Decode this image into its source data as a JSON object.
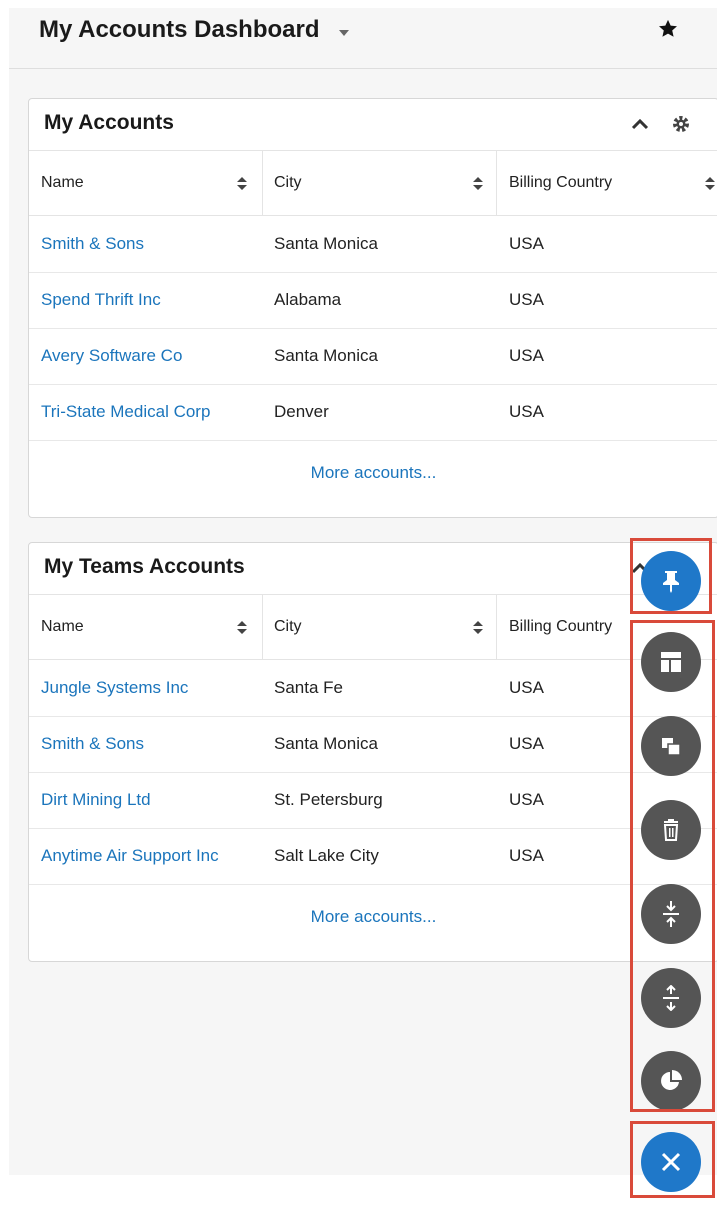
{
  "header": {
    "title": "My Accounts Dashboard"
  },
  "dashlet1": {
    "title": "My Accounts",
    "columns": [
      "Name",
      "City",
      "Billing Country"
    ],
    "rows": [
      {
        "name": "Smith & Sons",
        "city": "Santa Monica",
        "country": "USA"
      },
      {
        "name": "Spend Thrift Inc",
        "city": "Alabama",
        "country": "USA"
      },
      {
        "name": "Avery Software Co",
        "city": "Santa Monica",
        "country": "USA"
      },
      {
        "name": "Tri-State Medical Corp",
        "city": "Denver",
        "country": "USA"
      }
    ],
    "more_label": "More accounts..."
  },
  "dashlet2": {
    "title": "My Teams Accounts",
    "columns": [
      "Name",
      "City",
      "Billing Country"
    ],
    "rows": [
      {
        "name": "Jungle Systems Inc",
        "city": "Santa Fe",
        "country": "USA"
      },
      {
        "name": "Smith & Sons",
        "city": "Santa Monica",
        "country": "USA"
      },
      {
        "name": "Dirt Mining Ltd",
        "city": "St. Petersburg",
        "country": "USA"
      },
      {
        "name": "Anytime Air Support Inc",
        "city": "Salt Lake City",
        "country": "USA"
      }
    ],
    "more_label": "More accounts..."
  },
  "fab_menu": {
    "icons": [
      "pin-icon",
      "layout-icon",
      "duplicate-icon",
      "trash-icon",
      "collapse-all-icon",
      "expand-all-icon",
      "pie-chart-icon",
      "close-icon"
    ]
  },
  "colors": {
    "link": "#1b75bc",
    "fab_blue": "#1f78c9",
    "fab_gray": "#555555",
    "highlight": "#d94a3a"
  }
}
